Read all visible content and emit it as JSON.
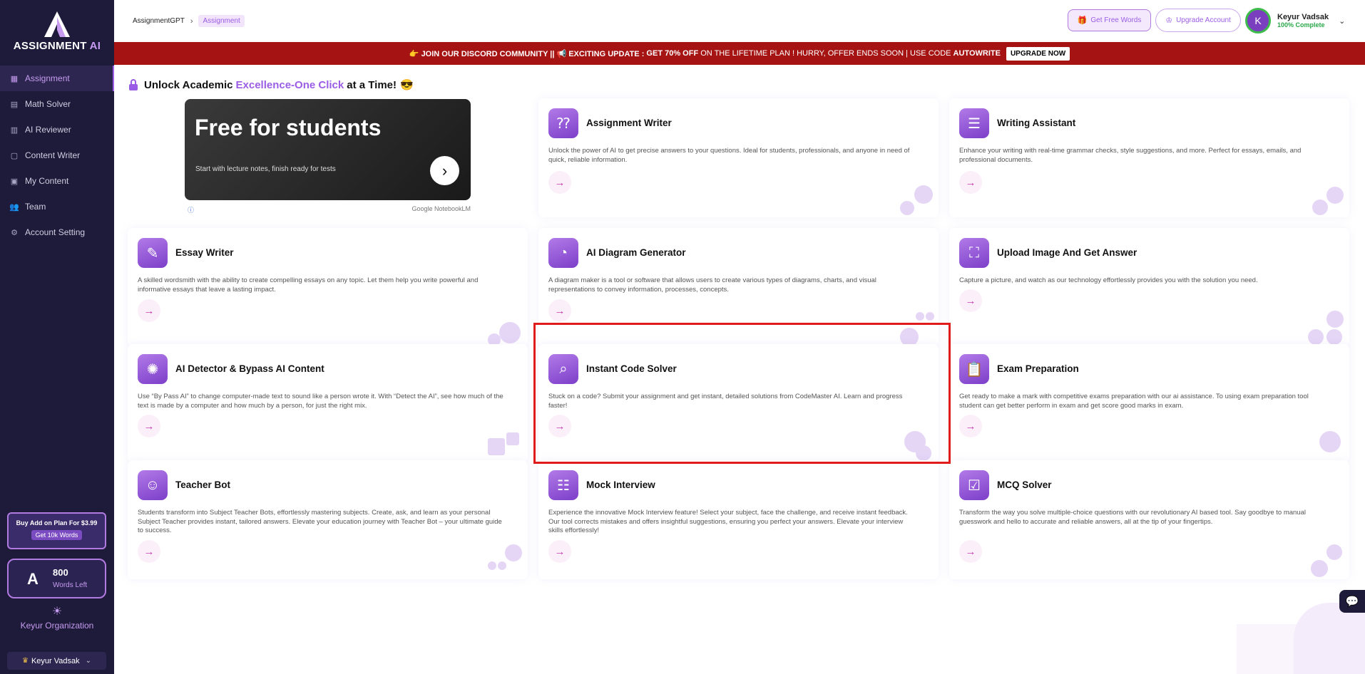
{
  "sidebar": {
    "brand": "ASSIGNMENT",
    "brand_ai": "AI",
    "items": [
      {
        "label": "Assignment",
        "icon": "grid-icon",
        "active": true
      },
      {
        "label": "Math Solver",
        "icon": "calculator-icon"
      },
      {
        "label": "AI Reviewer",
        "icon": "review-icon"
      },
      {
        "label": "Content Writer",
        "icon": "document-icon"
      },
      {
        "label": "My Content",
        "icon": "folder-icon"
      },
      {
        "label": "Team",
        "icon": "team-icon"
      },
      {
        "label": "Account Setting",
        "icon": "gear-icon"
      }
    ],
    "addon_text": "Buy Add on Plan For $3.99",
    "addon_button": "Get 10k Words",
    "words_count": "800",
    "words_label": "Words Left",
    "org_name": "Keyur Organization",
    "user_switch": "Keyur Vadsak"
  },
  "topbar": {
    "breadcrumb_root": "AssignmentGPT",
    "breadcrumb_current": "Assignment",
    "free_words": "Get Free Words",
    "upgrade": "Upgrade Account",
    "user_initial": "K",
    "user_name": "Keyur Vadsak",
    "user_status": "100% Complete"
  },
  "banner": {
    "text_1": "👉 JOIN OUR DISCORD COMMUNITY || 📢 EXCITING UPDATE : ",
    "highlight": "GET 70% OFF",
    "text_2": " ON THE LIFETIME PLAN ! HURRY, OFFER ENDS SOON | USE CODE ",
    "code": "AUTOWRITE",
    "cta": "UPGRADE NOW"
  },
  "heading": {
    "pre": "Unlock Academic",
    "highlight": "Excellence-One Click",
    "post": "at a Time!",
    "emoji": "😎"
  },
  "ad": {
    "headline": "Free for students",
    "subtext": "Start with lecture notes, finish ready for tests",
    "source": "Google NotebookLM"
  },
  "cards": [
    {
      "title": "Assignment Writer",
      "desc": "Unlock the power of AI to get precise answers to your questions. Ideal for students, professionals, and anyone in need of quick, reliable information.",
      "icon": "qa-icon"
    },
    {
      "title": "Writing Assistant",
      "desc": "Enhance your writing with real-time grammar checks, style suggestions, and more. Perfect for essays, emails, and professional documents.",
      "icon": "notebook-icon"
    },
    {
      "title": "Essay Writer",
      "desc": "A skilled wordsmith with the ability to create compelling essays on any topic. Let them help you write powerful and informative essays that leave a lasting impact.",
      "icon": "pen-paper-icon"
    },
    {
      "title": "AI Diagram Generator",
      "desc": "A diagram maker is a tool or software that allows users to create various types of diagrams, charts, and visual representations to convey information, processes, concepts.",
      "icon": "chart-icon"
    },
    {
      "title": "Upload Image And Get Answer",
      "desc": "Capture a picture, and watch as our technology effortlessly provides you with the solution you need.",
      "icon": "scan-icon"
    },
    {
      "title": "AI Detector & Bypass AI Content",
      "desc": "Use “By Pass AI” to change computer-made text to sound like a person wrote it. With “Detect the AI”, see how much of the text is made by a computer and how much by a person, for just the right mix.",
      "icon": "ai-chip-icon"
    },
    {
      "title": "Instant Code Solver",
      "desc": "Stuck on a code? Submit your assignment and get instant, detailed solutions from CodeMaster AI. Learn and progress faster!",
      "icon": "magnifier-icon"
    },
    {
      "title": "Exam Preparation",
      "desc": "Get ready to make a mark with competitive exams preparation with our ai assistance. To using exam preparation tool student can get better perform in exam and get score good marks in exam.",
      "icon": "clipboard-icon"
    },
    {
      "title": "Teacher Bot",
      "desc": "Students transform into Subject Teacher Bots, effortlessly mastering subjects. Create, ask, and learn as your personal Subject Teacher provides instant, tailored answers. Elevate your education journey with Teacher Bot – your ultimate guide to success.",
      "icon": "teacher-icon"
    },
    {
      "title": "Mock Interview",
      "desc": "Experience the innovative Mock Interview feature! Select your subject, face the challenge, and receive instant feedback. Our tool corrects mistakes and offers insightful suggestions, ensuring you perfect your answers. Elevate your interview skills effortlessly!",
      "icon": "interview-icon"
    },
    {
      "title": "MCQ Solver",
      "desc": "Transform the way you solve multiple-choice questions with our revolutionary AI based tool. Say goodbye to manual guesswork and hello to accurate and reliable answers, all at the tip of your fingertips.",
      "icon": "checklist-icon"
    }
  ],
  "colors": {
    "accent": "#9b5de5",
    "sidebar_bg": "#1d1a3a",
    "banner_bg": "#a51313",
    "highlight_box": "#e01b1b"
  }
}
